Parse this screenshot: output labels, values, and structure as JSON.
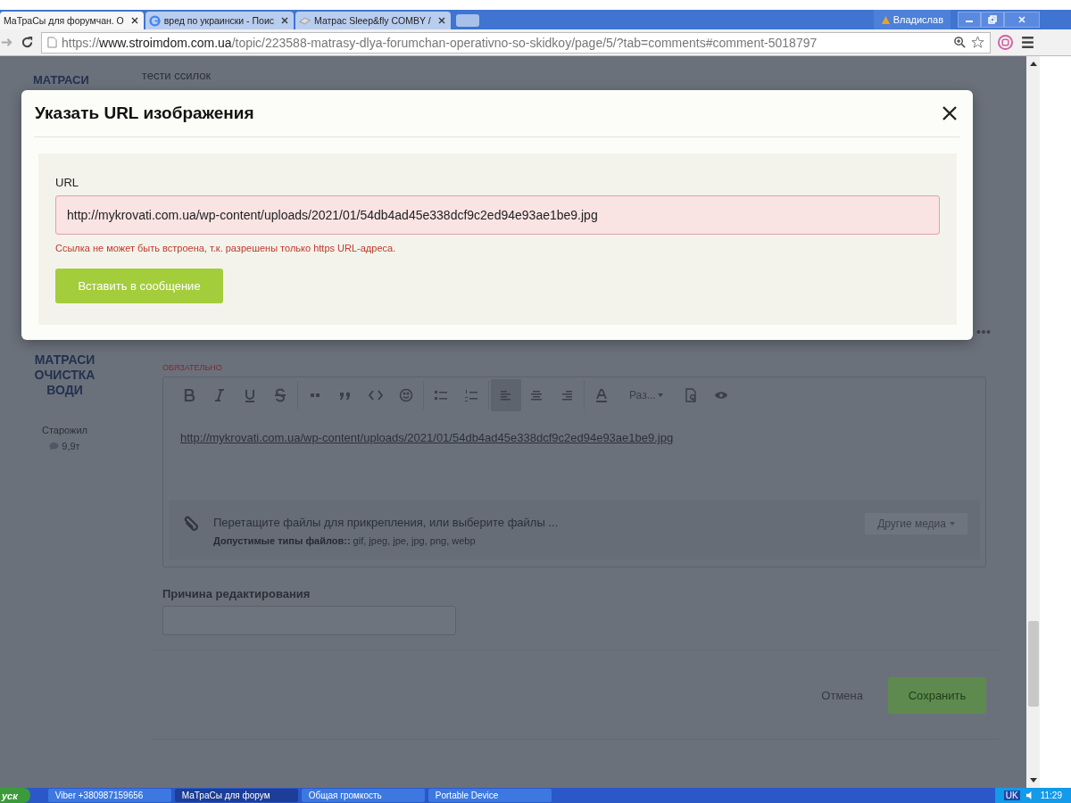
{
  "browser": {
    "tabs": [
      {
        "title": "МаТраСы для форумчан. О",
        "selected": true,
        "kind": "site"
      },
      {
        "title": "вред по украински - Поис",
        "selected": false,
        "kind": "google"
      },
      {
        "title": "Матрас Sleep&fly COMBY /",
        "selected": false,
        "kind": "page"
      }
    ],
    "user": "Владислав",
    "address": {
      "scheme": "https://",
      "host": "www.stroimdom.com.ua",
      "path": "/topic/223588-matrasy-dlya-forumchan-operativno-so-skidkoy/page/5/?tab=comments#comment-5018797"
    }
  },
  "page": {
    "top_post_text": "тести ссилок",
    "top_author": "МАТРАСИ",
    "author": {
      "name": "МАТРАСИ ОЧИСТКА ВОДИ",
      "rank": "Старожил",
      "posts": "9,9т"
    },
    "editor": {
      "required_label": "ОБЯЗАТЕЛЬНО",
      "toolbar": [
        {
          "kind": "bold",
          "selected": false
        },
        {
          "kind": "italic",
          "selected": false
        },
        {
          "kind": "underline",
          "selected": false
        },
        {
          "kind": "strike",
          "selected": false
        },
        {
          "kind": "sep"
        },
        {
          "kind": "link",
          "selected": false
        },
        {
          "kind": "quote",
          "selected": false
        },
        {
          "kind": "code",
          "selected": false
        },
        {
          "kind": "emoji",
          "selected": false
        },
        {
          "kind": "sep"
        },
        {
          "kind": "bullets",
          "selected": false
        },
        {
          "kind": "numbers",
          "selected": false
        },
        {
          "kind": "sep"
        },
        {
          "kind": "align-left",
          "selected": true
        },
        {
          "kind": "align-center",
          "selected": false
        },
        {
          "kind": "align-right",
          "selected": false
        },
        {
          "kind": "sep"
        },
        {
          "kind": "font-color",
          "selected": false
        },
        {
          "kind": "size",
          "label": "Раз..."
        },
        {
          "kind": "preview",
          "selected": false
        },
        {
          "kind": "eye",
          "selected": false
        }
      ],
      "content_link": "http://mykrovati.com.ua/wp-content/uploads/2021/01/54db4ad45e338dcf9c2ed94e93ae1be9.jpg",
      "attach": {
        "text": "Перетащите файлы для прикрепления, или выберите файлы ...",
        "allowed_label": "Допустимые типы файлов::",
        "allowed_types": "gif, jpeg, jpe, jpg, png, webp",
        "media_button": "Другие медиа"
      }
    },
    "reason": {
      "label": "Причина редактирования"
    },
    "actions": {
      "cancel": "Отмена",
      "save": "Сохранить"
    }
  },
  "modal": {
    "title": "Указать URL изображения",
    "url_label": "URL",
    "url_value": "http://mykrovati.com.ua/wp-content/uploads/2021/01/54db4ad45e338dcf9c2ed94e93ae1be9.jpg",
    "invalid": true,
    "error": "Ссылка не может быть встроена, т.к. разрешены только https URL-адреса.",
    "submit": "Вставить в сообщение"
  },
  "taskbar": {
    "start": "уск",
    "items": [
      {
        "label": "Viber +380987159656",
        "selected": false
      },
      {
        "label": "МаТраСы для форум",
        "selected": true
      },
      {
        "label": "Общая громкость",
        "selected": false
      },
      {
        "label": "Portable Device",
        "selected": false
      }
    ],
    "lang": "UK",
    "clock": "11:29"
  }
}
